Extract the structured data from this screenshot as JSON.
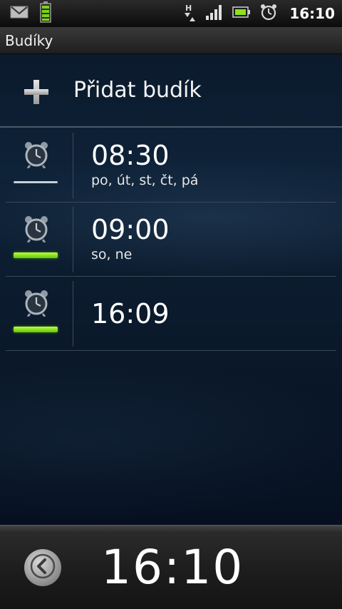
{
  "status_bar": {
    "time": "16:10",
    "icons": [
      "gmail-icon",
      "battery-charging-icon",
      "hspa-data-icon",
      "signal-icon",
      "battery-icon",
      "alarm-icon"
    ]
  },
  "title_bar": {
    "title": "Budíky"
  },
  "add_alarm": {
    "label": "Přidat budík",
    "icon": "plus-icon"
  },
  "alarms": [
    {
      "time": "08:30",
      "days": "po, út, st, čt, pá",
      "enabled": false
    },
    {
      "time": "09:00",
      "days": "so, ne",
      "enabled": true
    },
    {
      "time": "16:09",
      "days": "",
      "enabled": true
    }
  ],
  "bottom_bar": {
    "clock": "16:10",
    "back_icon": "back-arrow-icon"
  },
  "colors": {
    "accent_on": "#8be21e",
    "indicator_off": "#c9d0d6",
    "background": "#0b1a2c"
  }
}
